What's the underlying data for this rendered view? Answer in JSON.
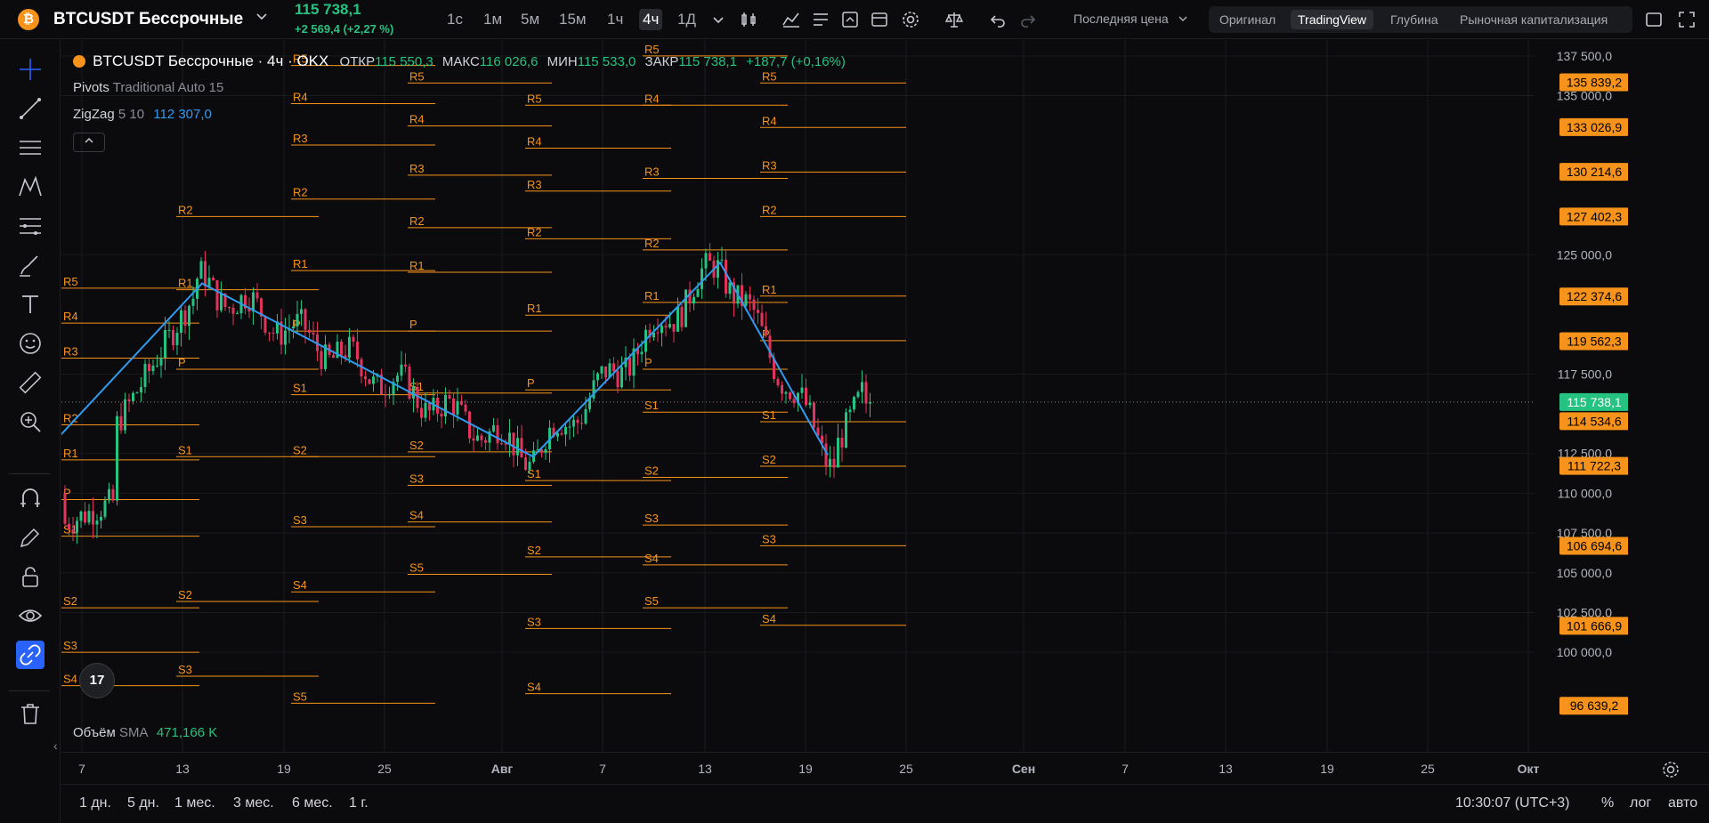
{
  "header": {
    "coin_glyph": "₿",
    "symbol": "BTCUSDT Бессрочные",
    "last_price": "115 738,1",
    "change": "+2 569,4 (+2,27 %)",
    "timeframes": [
      "1с",
      "1м",
      "5м",
      "15м",
      "1ч",
      "4ч",
      "1Д"
    ],
    "active_timeframe": "4ч",
    "price_type": "Последняя цена",
    "views": [
      "Оригинал",
      "TradingView",
      "Глубина",
      "Рыночная капитализация"
    ],
    "active_view": "TradingView"
  },
  "legend": {
    "title": "BTCUSDT Бессрочные · 4ч · OKX",
    "open_label": "ОТКР",
    "open": "115 550,3",
    "high_label": "МАКС",
    "high": "116 026,6",
    "low_label": "МИН",
    "low": "115 533,0",
    "close_label": "ЗАКР",
    "close": "115 738,1",
    "change": "+187,7 (+0,16%)",
    "pivots_name": "Pivots",
    "pivots_params": "Traditional Auto 15",
    "zigzag_name": "ZigZag",
    "zigzag_params": "5 10",
    "zigzag_value": "112 307,0",
    "tv_logo": "17"
  },
  "volume": {
    "name": "Объём",
    "ma": "SMA",
    "value": "471,166 K"
  },
  "colors": {
    "up": "#26c281",
    "down": "#e0345c",
    "pivot": "#f7931a",
    "zigzag": "#2f9bef",
    "bg": "#0b0b0d",
    "grid": "#1a1b1f"
  },
  "chart_data": {
    "type": "candlestick",
    "symbol": "BTCUSDT",
    "interval": "4ч",
    "y_axis_ticks": [
      "137 500,0",
      "135 000,0",
      "125 000,0",
      "117 500,0",
      "112 500,0",
      "110 000,0",
      "107 500,0",
      "105 000,0",
      "102 500,0",
      "100 000,0"
    ],
    "y_range": [
      95700,
      138500
    ],
    "price_labels": [
      "135 839,2",
      "133 026,9",
      "130 214,6",
      "127 402,3",
      "122 374,6",
      "119 562,3",
      "115 738,1",
      "114 534,6",
      "111 722,3",
      "106 694,6",
      "101 666,9",
      "96 639,2"
    ],
    "x_axis_ticks": [
      "7",
      "13",
      "19",
      "25",
      "Авг",
      "7",
      "13",
      "19",
      "25",
      "Сен",
      "7",
      "13",
      "19",
      "25",
      "Окт"
    ],
    "zigzag": [
      {
        "date": "Jul 6",
        "price": 113600
      },
      {
        "date": "Jul 14",
        "price": 123200
      },
      {
        "date": "Aug 2",
        "price": 112300
      },
      {
        "date": "Aug 14",
        "price": 124500
      },
      {
        "date": "Aug 21",
        "price": 112400
      }
    ],
    "pivot_levels": [
      {
        "labels": [
          "R5",
          "R4",
          "R3",
          "R2",
          "R1",
          "P",
          "S1",
          "S2",
          "S3",
          "S4"
        ],
        "values": [
          122900,
          120700,
          118500,
          114300,
          112100,
          109600,
          107300,
          102800,
          100000,
          97900
        ]
      },
      {
        "labels": [
          "R2",
          "R1",
          "P",
          "S1",
          "S2",
          "S3"
        ],
        "values": [
          127400,
          122800,
          117800,
          112300,
          103200,
          98500
        ]
      },
      {
        "labels": [
          "R5",
          "R4",
          "R3",
          "R2",
          "R1",
          "P",
          "S1",
          "S2",
          "S3",
          "S4",
          "S5"
        ],
        "values": [
          136900,
          134500,
          131900,
          128500,
          124000,
          120200,
          116200,
          112300,
          107900,
          103800,
          96800
        ]
      },
      {
        "labels": [
          "R5",
          "R4",
          "R3",
          "R2",
          "R1",
          "P",
          "S1",
          "S2",
          "S3",
          "S4",
          "S5"
        ],
        "values": [
          135800,
          133100,
          130000,
          126700,
          123900,
          120200,
          116300,
          112600,
          110500,
          108200,
          104900
        ]
      },
      {
        "labels": [
          "R5",
          "R4",
          "R3",
          "R2",
          "R1",
          "P",
          "S1",
          "S2",
          "S3",
          "S4"
        ],
        "values": [
          134400,
          131700,
          129000,
          126000,
          121200,
          116500,
          110800,
          106000,
          101500,
          97400
        ]
      },
      {
        "labels": [
          "R5",
          "R4",
          "R3",
          "R2",
          "R1",
          "P",
          "S1",
          "S2",
          "S3",
          "S4",
          "S5"
        ],
        "values": [
          137500,
          134400,
          129800,
          125300,
          122000,
          117800,
          115100,
          111000,
          108000,
          105500,
          102800
        ]
      },
      {
        "labels": [
          "R5",
          "R4",
          "R3",
          "R2",
          "R1",
          "P",
          "S1",
          "S2",
          "S3",
          "S4"
        ],
        "values": [
          135800,
          133000,
          130200,
          127400,
          122400,
          119600,
          114500,
          111700,
          106700,
          101700
        ]
      }
    ],
    "current_price": 115738.1
  },
  "range_buttons": [
    "1 дн.",
    "5 дн.",
    "1 мес.",
    "3 мес.",
    "6 мес.",
    "1 г."
  ],
  "clock": "10:30:07 (UTC+3)",
  "axis_options": [
    "%",
    "лог",
    "авто"
  ]
}
